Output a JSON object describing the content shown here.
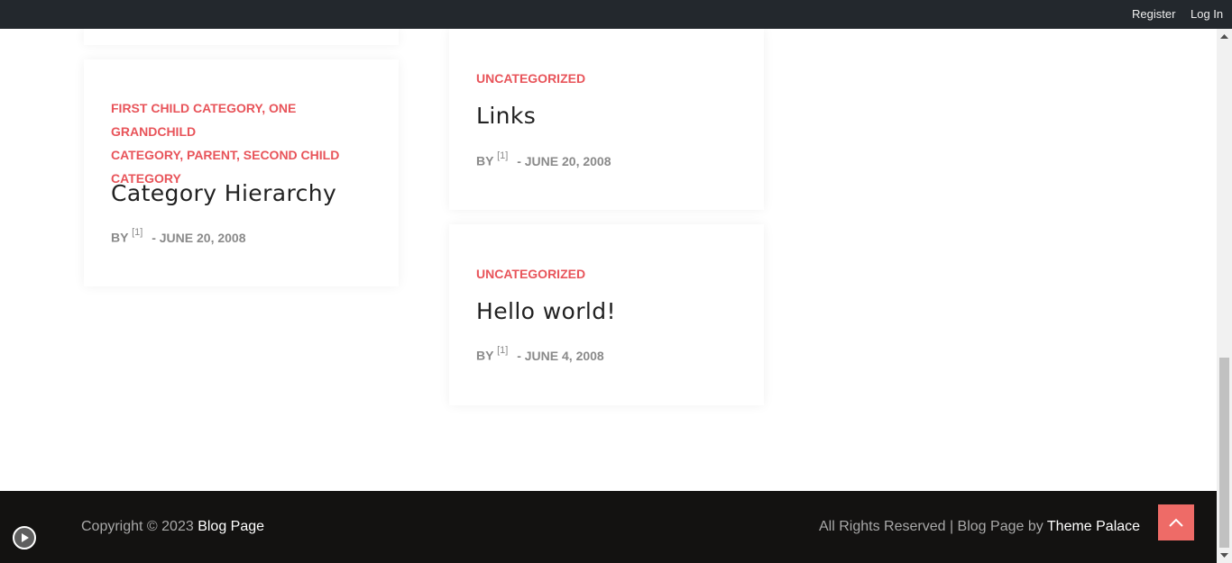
{
  "adminbar": {
    "register": "Register",
    "login": "Log In"
  },
  "posts": [
    {
      "categories": [
        "FIRST CHILD CATEGORY",
        "ONE GRANDCHILD",
        "CATEGORY",
        "PARENT",
        "SECOND CHILD",
        "CATEGORY"
      ],
      "separator": ",",
      "title": "Category Hierarchy",
      "by": "BY",
      "author": "[1]",
      "date": "- JUNE 20, 2008"
    },
    {
      "category": "UNCATEGORIZED",
      "title": "Links",
      "by": "BY",
      "author": "[1]",
      "date": "- JUNE 20, 2008"
    },
    {
      "category": "UNCATEGORIZED",
      "title": "Hello world!",
      "by": "BY",
      "author": "[1]",
      "date": "- JUNE 4, 2008"
    }
  ],
  "footer": {
    "copyright_prefix": "Copyright © 2023",
    "site_name": "Blog Page",
    "rights_prefix": "All Rights Reserved | Blog Page by",
    "theme_link": "Theme Palace"
  },
  "icons": {
    "scroll_top": "chevron-up-icon",
    "play": "play-icon"
  },
  "colors": {
    "accent": "#e8545a",
    "adminbar": "#23282d",
    "footer": "#131211",
    "scroll_top_bg": "#ee6b67"
  }
}
